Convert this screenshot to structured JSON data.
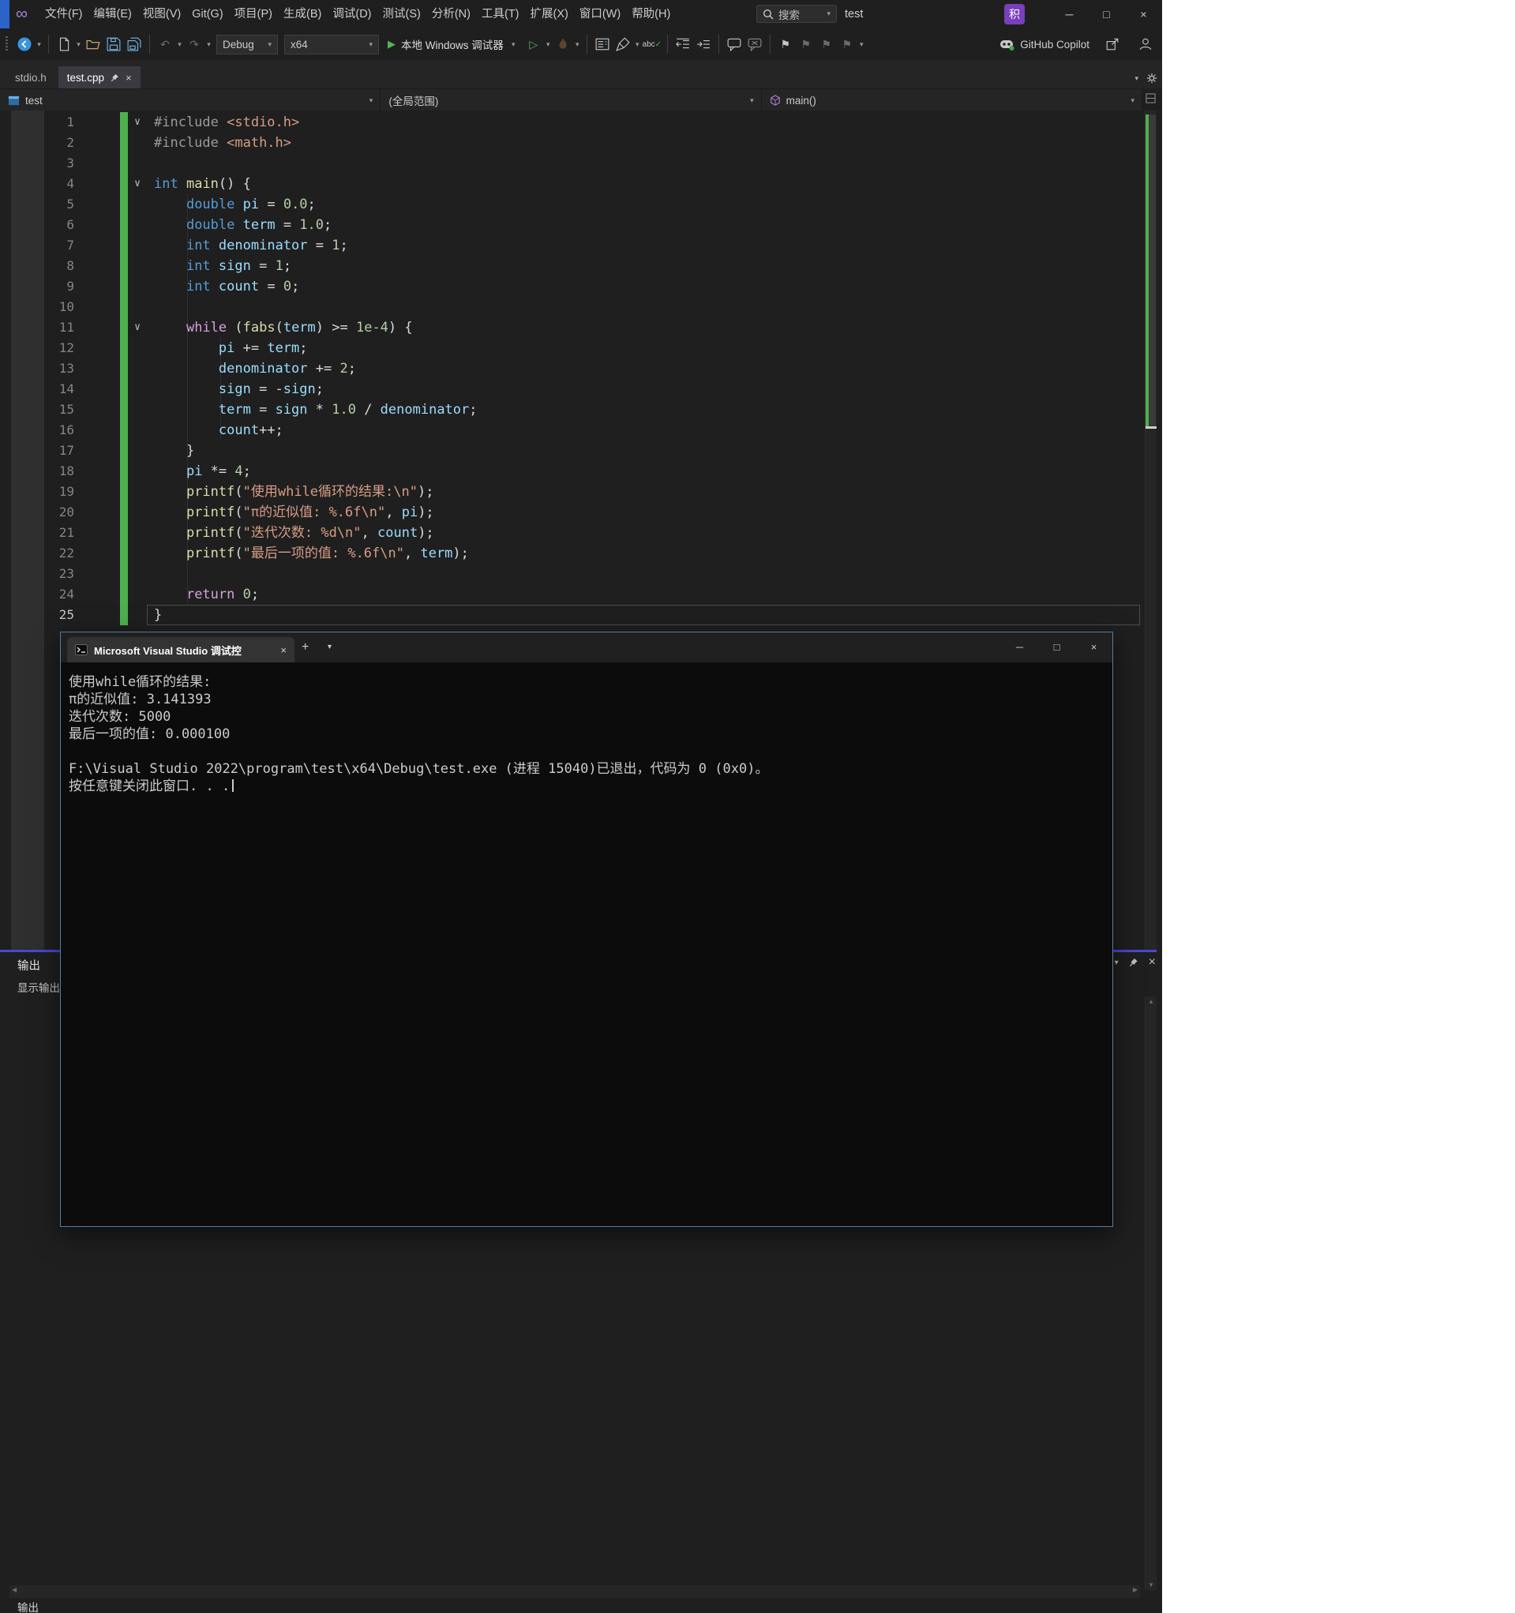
{
  "icons": {
    "minimize": "─",
    "maximize": "□",
    "close": "×",
    "caret_down": "▾",
    "fold_chevron": "∨",
    "undo": "↶",
    "redo": "↷",
    "play_filled": "▶",
    "play_outline": "▷",
    "plus": "+",
    "scroll_up": "▲",
    "scroll_down": "▼",
    "scroll_left": "◀",
    "scroll_right": "▶",
    "bookmark_flag": "⚑",
    "infinity_logo": "∞"
  },
  "titlebar": {
    "menus": [
      "文件(F)",
      "编辑(E)",
      "视图(V)",
      "Git(G)",
      "项目(P)",
      "生成(B)",
      "调试(D)",
      "测试(S)",
      "分析(N)",
      "工具(T)",
      "扩展(X)",
      "窗口(W)",
      "帮助(H)"
    ],
    "search_placeholder": "搜索",
    "solution_name": "test",
    "account_badge": "积"
  },
  "toolbar": {
    "config": "Debug",
    "platform": "x64",
    "start_debug_label": "本地 Windows 调试器",
    "spell_label": "abc",
    "copilot_label": "GitHub Copilot"
  },
  "tabstrip": {
    "tabs": [
      {
        "label": "stdio.h",
        "active": false
      },
      {
        "label": "test.cpp",
        "active": true
      }
    ]
  },
  "navbar": {
    "project": "test",
    "scope": "(全局范围)",
    "member": "main()"
  },
  "editor": {
    "current_line": 25,
    "fold_lines": [
      1,
      4,
      11
    ],
    "lines": [
      {
        "n": 1,
        "t": [
          [
            "pp",
            "#include "
          ],
          [
            "str",
            "<stdio.h>"
          ]
        ]
      },
      {
        "n": 2,
        "t": [
          [
            "pp",
            "#include "
          ],
          [
            "str",
            "<math.h>"
          ]
        ]
      },
      {
        "n": 3,
        "t": []
      },
      {
        "n": 4,
        "t": [
          [
            "kw",
            "int"
          ],
          [
            "pl",
            " "
          ],
          [
            "fn",
            "main"
          ],
          [
            "pl",
            "() {"
          ]
        ]
      },
      {
        "n": 5,
        "t": [
          [
            "pl",
            "    "
          ],
          [
            "kw",
            "double"
          ],
          [
            "pl",
            " "
          ],
          [
            "var",
            "pi"
          ],
          [
            "pl",
            " = "
          ],
          [
            "num",
            "0.0"
          ],
          [
            "pl",
            ";"
          ]
        ]
      },
      {
        "n": 6,
        "t": [
          [
            "pl",
            "    "
          ],
          [
            "kw",
            "double"
          ],
          [
            "pl",
            " "
          ],
          [
            "var",
            "term"
          ],
          [
            "pl",
            " = "
          ],
          [
            "num",
            "1.0"
          ],
          [
            "pl",
            ";"
          ]
        ]
      },
      {
        "n": 7,
        "t": [
          [
            "pl",
            "    "
          ],
          [
            "kw",
            "int"
          ],
          [
            "pl",
            " "
          ],
          [
            "var",
            "denominator"
          ],
          [
            "pl",
            " = "
          ],
          [
            "num",
            "1"
          ],
          [
            "pl",
            ";"
          ]
        ]
      },
      {
        "n": 8,
        "t": [
          [
            "pl",
            "    "
          ],
          [
            "kw",
            "int"
          ],
          [
            "pl",
            " "
          ],
          [
            "var",
            "sign"
          ],
          [
            "pl",
            " = "
          ],
          [
            "num",
            "1"
          ],
          [
            "pl",
            ";"
          ]
        ]
      },
      {
        "n": 9,
        "t": [
          [
            "pl",
            "    "
          ],
          [
            "kw",
            "int"
          ],
          [
            "pl",
            " "
          ],
          [
            "var",
            "count"
          ],
          [
            "pl",
            " = "
          ],
          [
            "num",
            "0"
          ],
          [
            "pl",
            ";"
          ]
        ]
      },
      {
        "n": 10,
        "t": []
      },
      {
        "n": 11,
        "t": [
          [
            "pl",
            "    "
          ],
          [
            "ctrl",
            "while"
          ],
          [
            "pl",
            " ("
          ],
          [
            "fn",
            "fabs"
          ],
          [
            "pl",
            "("
          ],
          [
            "var",
            "term"
          ],
          [
            "pl",
            ") >= "
          ],
          [
            "num",
            "1e-4"
          ],
          [
            "pl",
            ") {"
          ]
        ]
      },
      {
        "n": 12,
        "t": [
          [
            "pl",
            "        "
          ],
          [
            "var",
            "pi"
          ],
          [
            "pl",
            " += "
          ],
          [
            "var",
            "term"
          ],
          [
            "pl",
            ";"
          ]
        ]
      },
      {
        "n": 13,
        "t": [
          [
            "pl",
            "        "
          ],
          [
            "var",
            "denominator"
          ],
          [
            "pl",
            " += "
          ],
          [
            "num",
            "2"
          ],
          [
            "pl",
            ";"
          ]
        ]
      },
      {
        "n": 14,
        "t": [
          [
            "pl",
            "        "
          ],
          [
            "var",
            "sign"
          ],
          [
            "pl",
            " = -"
          ],
          [
            "var",
            "sign"
          ],
          [
            "pl",
            ";"
          ]
        ]
      },
      {
        "n": 15,
        "t": [
          [
            "pl",
            "        "
          ],
          [
            "var",
            "term"
          ],
          [
            "pl",
            " = "
          ],
          [
            "var",
            "sign"
          ],
          [
            "pl",
            " * "
          ],
          [
            "num",
            "1.0"
          ],
          [
            "pl",
            " / "
          ],
          [
            "var",
            "denominator"
          ],
          [
            "pl",
            ";"
          ]
        ]
      },
      {
        "n": 16,
        "t": [
          [
            "pl",
            "        "
          ],
          [
            "var",
            "count"
          ],
          [
            "pl",
            "++;"
          ]
        ]
      },
      {
        "n": 17,
        "t": [
          [
            "pl",
            "    }"
          ]
        ]
      },
      {
        "n": 18,
        "t": [
          [
            "pl",
            "    "
          ],
          [
            "var",
            "pi"
          ],
          [
            "pl",
            " *= "
          ],
          [
            "num",
            "4"
          ],
          [
            "pl",
            ";"
          ]
        ]
      },
      {
        "n": 19,
        "t": [
          [
            "pl",
            "    "
          ],
          [
            "fn",
            "printf"
          ],
          [
            "pl",
            "("
          ],
          [
            "str",
            "\"使用while循环的结果:\\n\""
          ],
          [
            "pl",
            ");"
          ]
        ]
      },
      {
        "n": 20,
        "t": [
          [
            "pl",
            "    "
          ],
          [
            "fn",
            "printf"
          ],
          [
            "pl",
            "("
          ],
          [
            "str",
            "\"π的近似值: %.6f\\n\""
          ],
          [
            "pl",
            ", "
          ],
          [
            "var",
            "pi"
          ],
          [
            "pl",
            ");"
          ]
        ]
      },
      {
        "n": 21,
        "t": [
          [
            "pl",
            "    "
          ],
          [
            "fn",
            "printf"
          ],
          [
            "pl",
            "("
          ],
          [
            "str",
            "\"迭代次数: %d\\n\""
          ],
          [
            "pl",
            ", "
          ],
          [
            "var",
            "count"
          ],
          [
            "pl",
            ");"
          ]
        ]
      },
      {
        "n": 22,
        "t": [
          [
            "pl",
            "    "
          ],
          [
            "fn",
            "printf"
          ],
          [
            "pl",
            "("
          ],
          [
            "str",
            "\"最后一项的值: %.6f\\n\""
          ],
          [
            "pl",
            ", "
          ],
          [
            "var",
            "term"
          ],
          [
            "pl",
            ");"
          ]
        ]
      },
      {
        "n": 23,
        "t": []
      },
      {
        "n": 24,
        "t": [
          [
            "pl",
            "    "
          ],
          [
            "ctrl",
            "return"
          ],
          [
            "pl",
            " "
          ],
          [
            "num",
            "0"
          ],
          [
            "pl",
            ";"
          ]
        ]
      },
      {
        "n": 25,
        "t": [
          [
            "pl",
            "}"
          ]
        ]
      }
    ]
  },
  "console_window": {
    "tab_title": "Microsoft Visual Studio 调试控",
    "lines": [
      "使用while循环的结果:",
      "π的近似值: 3.141393",
      "迭代次数: 5000",
      "最后一项的值: 0.000100",
      "",
      "F:\\Visual Studio 2022\\program\\test\\x64\\Debug\\test.exe (进程 15040)已退出，代码为 0 (0x0)。",
      "按任意键关闭此窗口. . ."
    ]
  },
  "output_panel": {
    "title": "输出",
    "source_label": "显示输出",
    "bottom_tab": "输出"
  }
}
